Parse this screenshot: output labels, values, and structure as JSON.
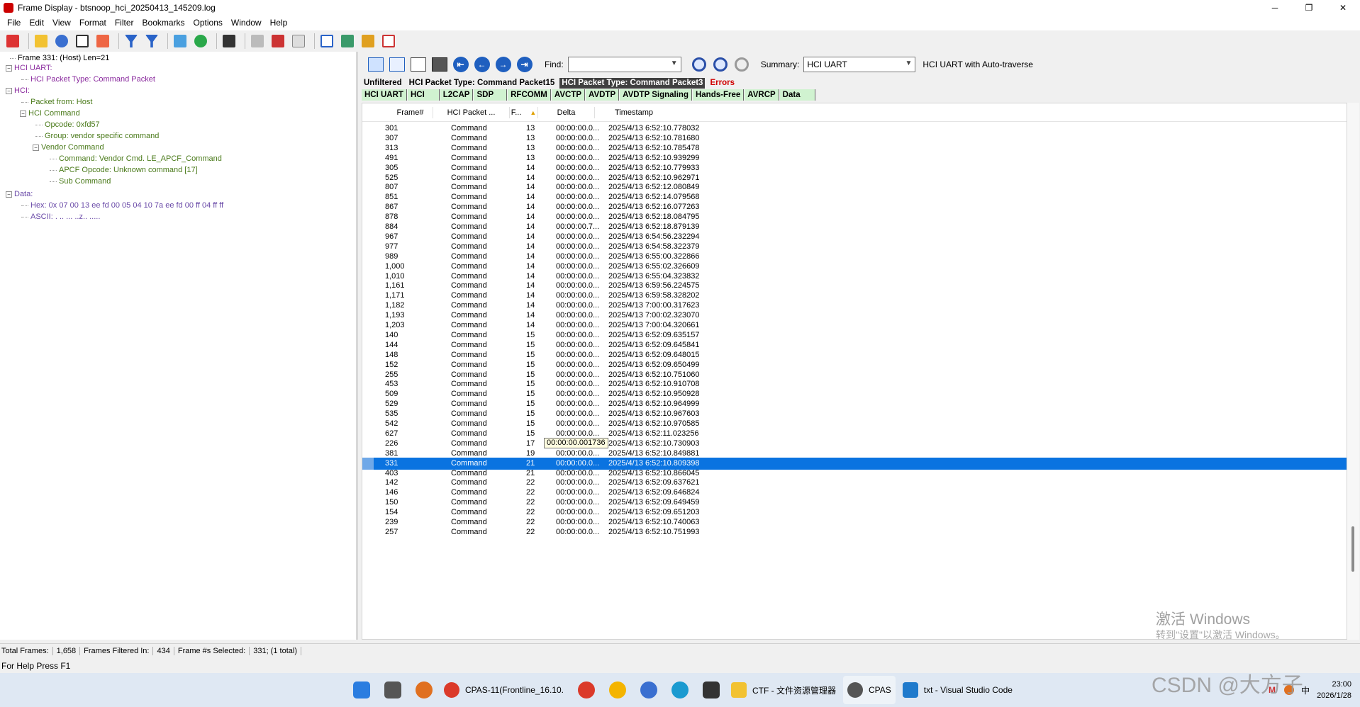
{
  "window": {
    "title": "Frame Display - btsnoop_hci_20250413_145209.log",
    "controls": [
      "─",
      "❐",
      "✕"
    ]
  },
  "menu": [
    "File",
    "Edit",
    "View",
    "Format",
    "Filter",
    "Bookmarks",
    "Options",
    "Window",
    "Help"
  ],
  "tree": {
    "frame_label": "Frame 331: (Host) Len=21",
    "hci_uart": "HCI UART:",
    "hci_packet_type": "HCI Packet Type: Command Packet",
    "hci": "HCI:",
    "packet_from": "Packet from: Host",
    "hci_command": "HCI Command",
    "opcode": "Opcode: 0xfd57",
    "group": "Group: vendor specific command",
    "vendor_command": "Vendor Command",
    "command": "Command: Vendor Cmd. LE_APCF_Command",
    "apcf_opcode": "APCF Opcode: Unknown command [17]",
    "sub_command": "Sub Command",
    "data": "Data:",
    "hex": "Hex: 0x 07 00 13 ee fd 00 05 04 10 7a ee fd 00 ff 04 ff ff",
    "ascii": "ASCII: . .. ... ..z.. ....."
  },
  "right_toolbar": {
    "find_label": "Find:",
    "find_value": "",
    "summary_label": "Summary:",
    "summary_value": "HCI UART",
    "summary_desc": "HCI UART with Auto-traverse"
  },
  "filter_tabs": [
    {
      "label": "Unfiltered",
      "state": "normal"
    },
    {
      "label": "HCI Packet Type: Command Packet15",
      "state": "normal"
    },
    {
      "label": "HCI Packet Type: Command Packet3",
      "state": "active"
    },
    {
      "label": "Errors",
      "state": "errors"
    }
  ],
  "layer_tabs": [
    "HCI UART",
    "HCI",
    "L2CAP",
    "SDP",
    "RFCOMM",
    "AVCTP",
    "AVDTP",
    "AVDTP Signaling",
    "Hands-Free",
    "AVRCP",
    "Data"
  ],
  "table": {
    "columns": [
      "Frame#",
      "HCI Packet ...",
      "F...",
      "Delta",
      "Timestamp"
    ],
    "sort_indicator": "▲",
    "tooltip": "00:00:00.001736",
    "tooltip_row": 32,
    "selected_row": 34,
    "rows": [
      [
        "301",
        "Command",
        "13",
        "00:00:00.0...",
        "2025/4/13 6:52:10.778032"
      ],
      [
        "307",
        "Command",
        "13",
        "00:00:00.0...",
        "2025/4/13 6:52:10.781680"
      ],
      [
        "313",
        "Command",
        "13",
        "00:00:00.0...",
        "2025/4/13 6:52:10.785478"
      ],
      [
        "491",
        "Command",
        "13",
        "00:00:00.0...",
        "2025/4/13 6:52:10.939299"
      ],
      [
        "305",
        "Command",
        "14",
        "00:00:00.0...",
        "2025/4/13 6:52:10.779933"
      ],
      [
        "525",
        "Command",
        "14",
        "00:00:00.0...",
        "2025/4/13 6:52:10.962971"
      ],
      [
        "807",
        "Command",
        "14",
        "00:00:00.0...",
        "2025/4/13 6:52:12.080849"
      ],
      [
        "851",
        "Command",
        "14",
        "00:00:00.0...",
        "2025/4/13 6:52:14.079568"
      ],
      [
        "867",
        "Command",
        "14",
        "00:00:00.0...",
        "2025/4/13 6:52:16.077263"
      ],
      [
        "878",
        "Command",
        "14",
        "00:00:00.0...",
        "2025/4/13 6:52:18.084795"
      ],
      [
        "884",
        "Command",
        "14",
        "00:00:00.7...",
        "2025/4/13 6:52:18.879139"
      ],
      [
        "967",
        "Command",
        "14",
        "00:00:00.0...",
        "2025/4/13 6:54:56.232294"
      ],
      [
        "977",
        "Command",
        "14",
        "00:00:00.0...",
        "2025/4/13 6:54:58.322379"
      ],
      [
        "989",
        "Command",
        "14",
        "00:00:00.0...",
        "2025/4/13 6:55:00.322866"
      ],
      [
        "1,000",
        "Command",
        "14",
        "00:00:00.0...",
        "2025/4/13 6:55:02.326609"
      ],
      [
        "1,010",
        "Command",
        "14",
        "00:00:00.0...",
        "2025/4/13 6:55:04.323832"
      ],
      [
        "1,161",
        "Command",
        "14",
        "00:00:00.0...",
        "2025/4/13 6:59:56.224575"
      ],
      [
        "1,171",
        "Command",
        "14",
        "00:00:00.0...",
        "2025/4/13 6:59:58.328202"
      ],
      [
        "1,182",
        "Command",
        "14",
        "00:00:00.0...",
        "2025/4/13 7:00:00.317623"
      ],
      [
        "1,193",
        "Command",
        "14",
        "00:00:00.0...",
        "2025/4/13 7:00:02.323070"
      ],
      [
        "1,203",
        "Command",
        "14",
        "00:00:00.0...",
        "2025/4/13 7:00:04.320661"
      ],
      [
        "140",
        "Command",
        "15",
        "00:00:00.0...",
        "2025/4/13 6:52:09.635157"
      ],
      [
        "144",
        "Command",
        "15",
        "00:00:00.0...",
        "2025/4/13 6:52:09.645841"
      ],
      [
        "148",
        "Command",
        "15",
        "00:00:00.0...",
        "2025/4/13 6:52:09.648015"
      ],
      [
        "152",
        "Command",
        "15",
        "00:00:00.0...",
        "2025/4/13 6:52:09.650499"
      ],
      [
        "255",
        "Command",
        "15",
        "00:00:00.0...",
        "2025/4/13 6:52:10.751060"
      ],
      [
        "453",
        "Command",
        "15",
        "00:00:00.0...",
        "2025/4/13 6:52:10.910708"
      ],
      [
        "509",
        "Command",
        "15",
        "00:00:00.0...",
        "2025/4/13 6:52:10.950928"
      ],
      [
        "529",
        "Command",
        "15",
        "00:00:00.0...",
        "2025/4/13 6:52:10.964999"
      ],
      [
        "535",
        "Command",
        "15",
        "00:00:00.0...",
        "2025/4/13 6:52:10.967603"
      ],
      [
        "542",
        "Command",
        "15",
        "00:00:00.0...",
        "2025/4/13 6:52:10.970585"
      ],
      [
        "627",
        "Command",
        "15",
        "00:00:00.0...",
        "2025/4/13 6:52:11.023256"
      ],
      [
        "226",
        "Command",
        "17",
        "",
        "2025/4/13 6:52:10.730903"
      ],
      [
        "381",
        "Command",
        "19",
        "00:00:00.0...",
        "2025/4/13 6:52:10.849881"
      ],
      [
        "331",
        "Command",
        "21",
        "00:00:00.0...",
        "2025/4/13 6:52:10.809398"
      ],
      [
        "403",
        "Command",
        "21",
        "00:00:00.0...",
        "2025/4/13 6:52:10.866045"
      ],
      [
        "142",
        "Command",
        "22",
        "00:00:00.0...",
        "2025/4/13 6:52:09.637621"
      ],
      [
        "146",
        "Command",
        "22",
        "00:00:00.0...",
        "2025/4/13 6:52:09.646824"
      ],
      [
        "150",
        "Command",
        "22",
        "00:00:00.0...",
        "2025/4/13 6:52:09.649459"
      ],
      [
        "154",
        "Command",
        "22",
        "00:00:00.0...",
        "2025/4/13 6:52:09.651203"
      ],
      [
        "239",
        "Command",
        "22",
        "00:00:00.0...",
        "2025/4/13 6:52:10.740063"
      ],
      [
        "257",
        "Command",
        "22",
        "00:00:00.0...",
        "2025/4/13 6:52:10.751993"
      ]
    ]
  },
  "status": {
    "total_frames_label": "Total Frames:",
    "total_frames": "1,658",
    "filtered_label": "Frames Filtered In:",
    "filtered": "434",
    "selected_label": "Frame #s Selected:",
    "selected": "331; (1 total)",
    "help": "For Help Press F1"
  },
  "watermark": {
    "line1": "激活 Windows",
    "line2": "转到\"设置\"以激活 Windows。",
    "csdn": "CSDN @大方子"
  },
  "taskbar": {
    "items": [
      {
        "label": "CPAS-11(Frontline_16.10.",
        "active": false
      },
      {
        "label": "CTF - 文件资源管理器",
        "active": false
      },
      {
        "label": "CPAS",
        "active": true
      },
      {
        "label": "txt - Visual Studio Code",
        "active": false
      }
    ],
    "tray_lang": "中",
    "clock_time": "23:00",
    "clock_date": "2026/1/28"
  },
  "colors": {
    "selection": "#0a73e0",
    "tree_purple": "#8a2a9e",
    "tree_green": "#4a7a1a",
    "layer_tab_bg": "#d0f2d0",
    "errors": "#d00000"
  }
}
